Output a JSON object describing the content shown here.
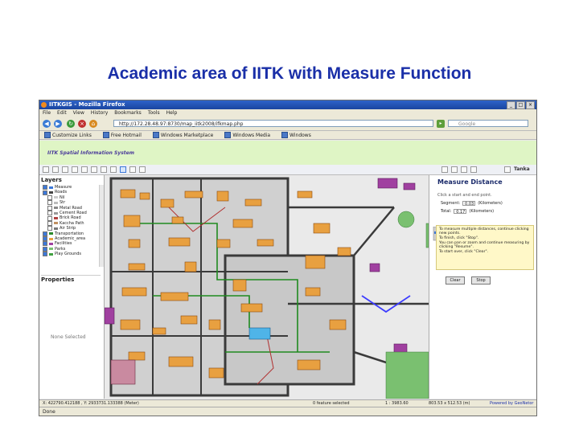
{
  "slide": {
    "title": "Academic area of IITK with Measure Function"
  },
  "window": {
    "title": "IITKGIS - Mozilla Firefox",
    "min": "_",
    "max": "□",
    "close": "×"
  },
  "menu": [
    "File",
    "Edit",
    "View",
    "History",
    "Bookmarks",
    "Tools",
    "Help"
  ],
  "nav": {
    "url": "http://172.28.48.97:8730/map_iitk2008/ifkmap.php",
    "search_placeholder": "Google"
  },
  "bookmarks": [
    "Customize Links",
    "Free Hotmail",
    "Windows Marketplace",
    "Windows Media",
    "Windows"
  ],
  "app": {
    "banner": "IITK Spatial Information System",
    "brand": "Tanka"
  },
  "layers": {
    "heading": "Layers",
    "items": [
      {
        "label": "Measure",
        "checked": true,
        "color": "#3c78d8"
      },
      {
        "label": "Roads",
        "checked": true,
        "color": "#444444"
      },
      {
        "label": "Nil",
        "checked": false,
        "color": "#cccccc"
      },
      {
        "label": "Str",
        "checked": false,
        "color": "#bbbbbb"
      },
      {
        "label": "Metal Road",
        "checked": false,
        "color": "#888888"
      },
      {
        "label": "Cement Road",
        "checked": false,
        "color": "#999999"
      },
      {
        "label": "Brick Road",
        "checked": false,
        "color": "#b04040"
      },
      {
        "label": "Kaccha Path",
        "checked": false,
        "color": "#c09060"
      },
      {
        "label": "Air Strip",
        "checked": false,
        "color": "#777777"
      },
      {
        "label": "Transportation",
        "checked": true,
        "color": "#2a8a2a"
      },
      {
        "label": "Academic_area",
        "checked": true,
        "color": "#e8a040"
      },
      {
        "label": "Facilities",
        "checked": true,
        "color": "#a040a0"
      },
      {
        "label": "Parks",
        "checked": true,
        "color": "#7ac070"
      },
      {
        "label": "Play Grounds",
        "checked": true,
        "color": "#40a040"
      }
    ]
  },
  "properties": {
    "heading": "Properties",
    "none": "None Selected"
  },
  "measure": {
    "heading": "Measure Distance",
    "instruction": "Click a start and end point.",
    "segment_label": "Segment:",
    "segment_value": "0.03",
    "segment_unit": "(Kilometers)",
    "total_label": "Total:",
    "total_value": "0.17",
    "total_unit": "(Kilometers)",
    "tips": [
      "To measure multiple distances, continue clicking new points.",
      "To finish, click \"Stop\".",
      "You can pan or zoom and continue measuring by clicking \"Resume\".",
      "To start over, click \"Clear\"."
    ],
    "clear": "Clear",
    "stop": "Stop"
  },
  "status": {
    "coords": "X: 422790.412188 , Y: 2933731.133388 (Meter)",
    "features": "0 feature selected",
    "scale": "1 : 3983.60",
    "size": "803.53 x 512.53 (m)",
    "powered": "Powered by GeoNetor"
  },
  "statusbar": {
    "done": "Done"
  }
}
